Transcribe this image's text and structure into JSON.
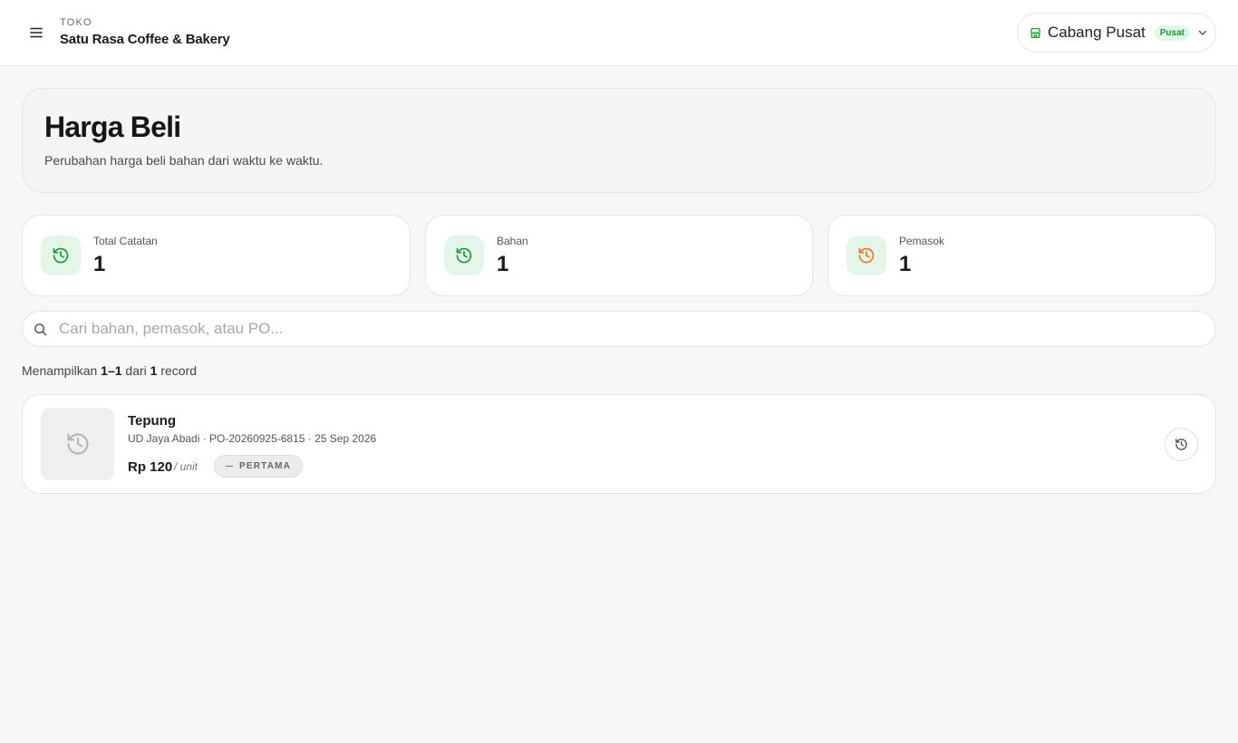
{
  "topbar": {
    "store_label": "TOKO",
    "store_name": "Satu Rasa Coffee & Bakery",
    "branch": {
      "name": "Cabang Pusat",
      "badge": "Pusat"
    }
  },
  "header": {
    "title": "Harga Beli",
    "subtitle": "Perubahan harga beli bahan dari waktu ke waktu."
  },
  "stats": [
    {
      "label": "Total Catatan",
      "value": "1",
      "icon": "history-icon",
      "accent": "#1a9a3a",
      "bg": "#e4f6e8"
    },
    {
      "label": "Bahan",
      "value": "1",
      "icon": "history-icon",
      "accent": "#1a9a3a",
      "bg": "#e4f6e8"
    },
    {
      "label": "Pemasok",
      "value": "1",
      "icon": "history-icon",
      "accent": "#e8772e",
      "bg": "#e4f6e8"
    }
  ],
  "search": {
    "placeholder": "Cari bahan, pemasok, atau PO...",
    "value": ""
  },
  "result_info": {
    "prefix": "Menampilkan",
    "range": "1–1",
    "middle": "dari",
    "total": "1",
    "suffix": "record"
  },
  "records": [
    {
      "title": "Tepung",
      "meta": "UD Jaya Abadi · PO-20260925-6815 · 25 Sep 2026",
      "price": "Rp 120",
      "unit": "/ unit",
      "badge": "PERTAMA"
    }
  ]
}
